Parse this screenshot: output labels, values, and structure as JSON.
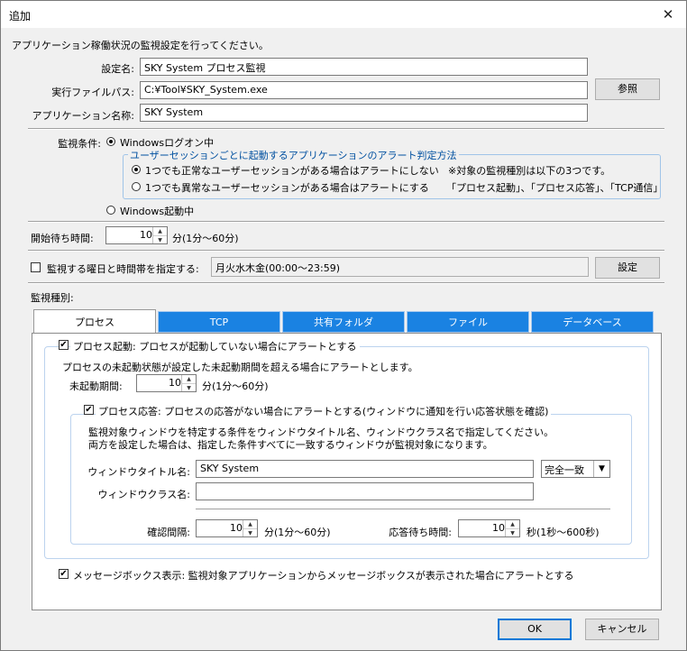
{
  "window": {
    "title": "追加",
    "close_glyph": "✕"
  },
  "intro": "アプリケーション稼働状況の監視設定を行ってください。",
  "fields": {
    "setting_name": {
      "label": "設定名:",
      "value": "SKY System プロセス監視"
    },
    "exe_path": {
      "label": "実行ファイルパス:",
      "value": "C:¥Tool¥SKY_System.exe"
    },
    "app_name": {
      "label": "アプリケーション名称:",
      "value": "SKY System"
    }
  },
  "browse_label": "参照",
  "condition": {
    "label": "監視条件:",
    "opt_logon": "Windowsログオン中",
    "group_title": "ユーザーセッションごとに起動するアプリケーションのアラート判定方法",
    "sub_opt1": "1つでも正常なユーザーセッションがある場合はアラートにしない",
    "sub_opt2": "1つでも異常なユーザーセッションがある場合はアラートにする",
    "note1": "※対象の監視種別は以下の3つです。",
    "note2": "「プロセス起動」、「プロセス応答」、「TCP通信」",
    "opt_startup": "Windows起動中"
  },
  "wait": {
    "label": "開始待ち時間:",
    "value": "10",
    "unit": "分(1分～60分)"
  },
  "schedule": {
    "label": "監視する曜日と時間帯を指定する:",
    "value": "月火水木金(00:00～23:59)",
    "button": "設定"
  },
  "monitor_type_label": "監視種別:",
  "tabs": [
    {
      "label": "プロセス"
    },
    {
      "label": "TCP"
    },
    {
      "label": "共有フォルダ"
    },
    {
      "label": "ファイル"
    },
    {
      "label": "データベース"
    }
  ],
  "process": {
    "start_check": "プロセス起動: プロセスが起動していない場合にアラートとする",
    "start_desc": "プロセスの未起動状態が設定した未起動期間を超える場合にアラートとします。",
    "period_label": "未起動期間:",
    "period_value": "10",
    "period_unit": "分(1分～60分)",
    "resp_check": "プロセス応答: プロセスの応答がない場合にアラートとする(ウィンドウに通知を行い応答状態を確認)",
    "resp_desc1": "監視対象ウィンドウを特定する条件をウィンドウタイトル名、ウィンドウクラス名で指定してください。",
    "resp_desc2": "両方を設定した場合は、指定した条件すべてに一致するウィンドウが監視対象になります。",
    "wtitle_label": "ウィンドウタイトル名:",
    "wtitle_value": "SKY System",
    "match_value": "完全一致",
    "wclass_label": "ウィンドウクラス名:",
    "wclass_value": "",
    "interval_label": "確認間隔:",
    "interval_value": "10",
    "interval_unit": "分(1分～60分)",
    "respwait_label": "応答待ち時間:",
    "respwait_value": "10",
    "respwait_unit": "秒(1秒～600秒)",
    "msgbox_check": "メッセージボックス表示: 監視対象アプリケーションからメッセージボックスが表示された場合にアラートとする"
  },
  "buttons": {
    "ok": "OK",
    "cancel": "キャンセル"
  },
  "glyphs": {
    "check": "✔",
    "spin_up": "▲",
    "spin_down": "▼",
    "dropdown": "▼"
  }
}
